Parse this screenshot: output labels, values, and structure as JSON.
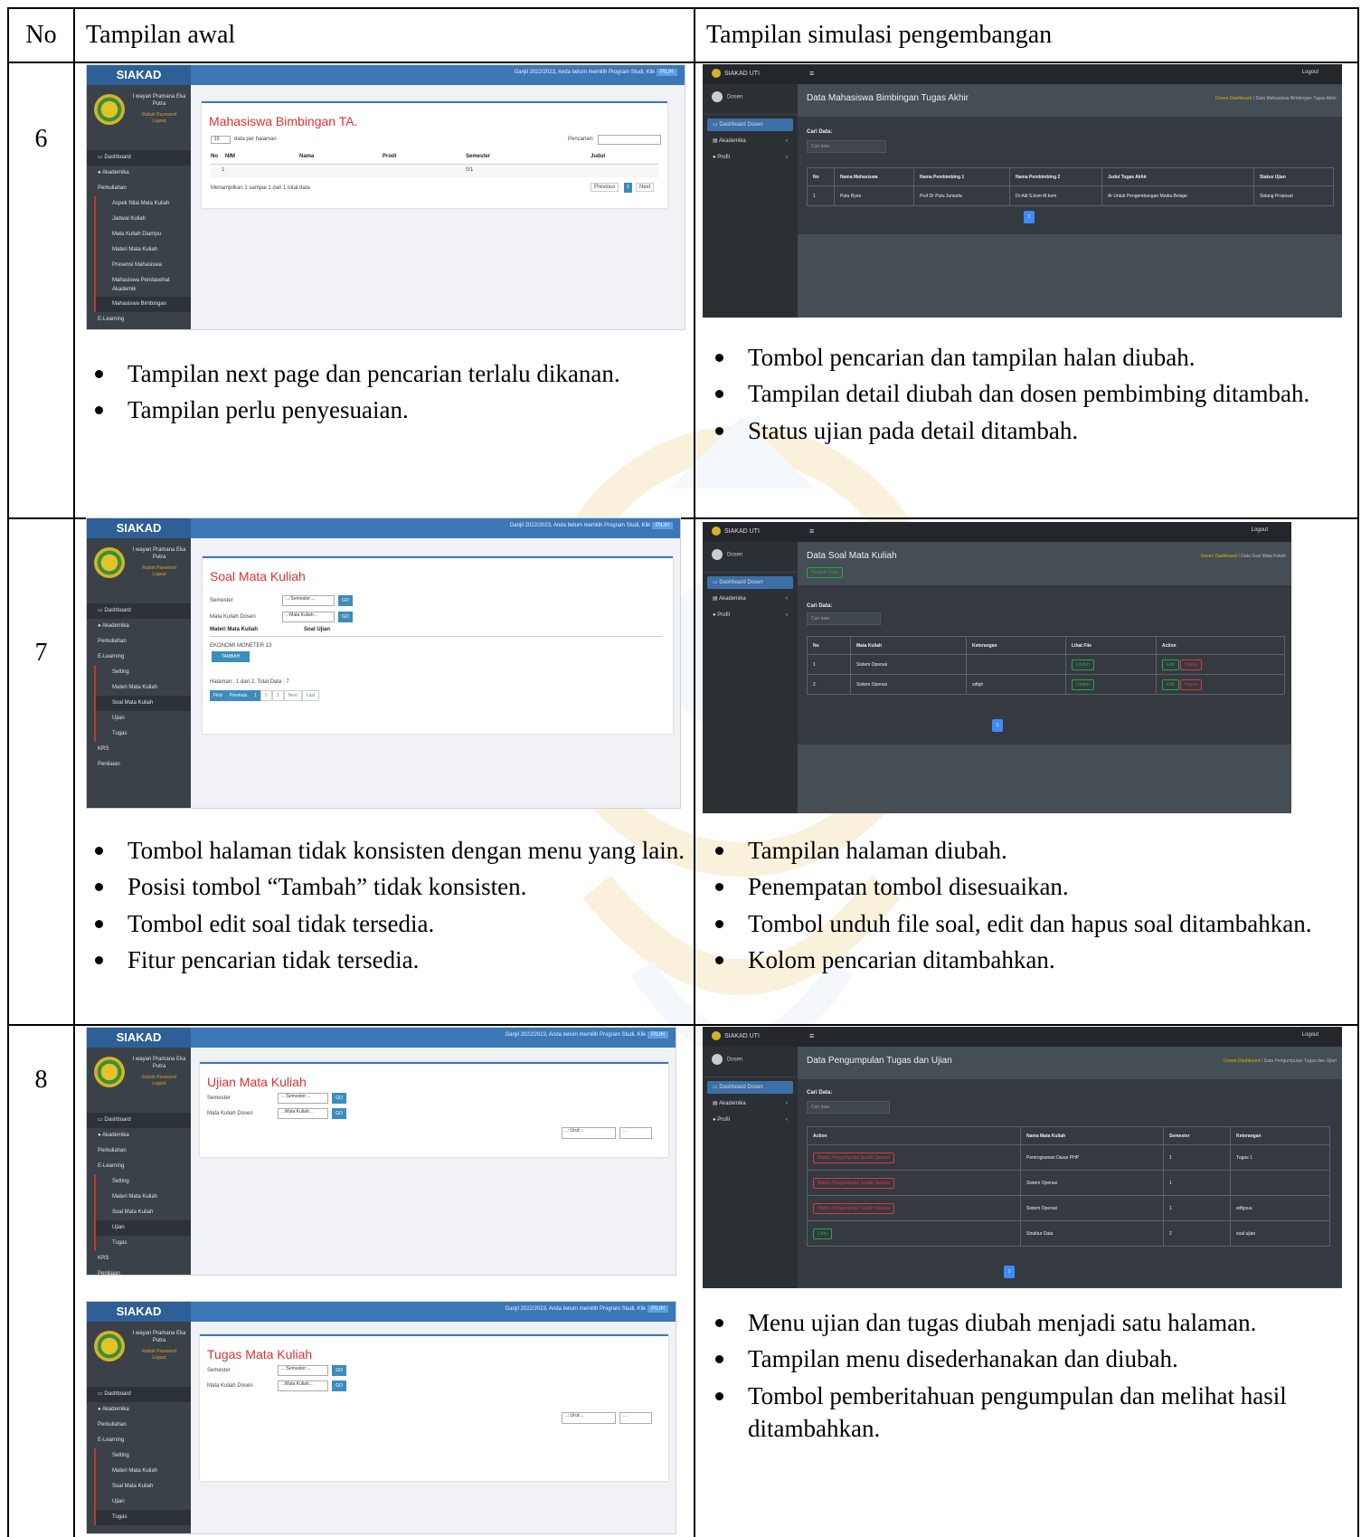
{
  "header": {
    "no": "No",
    "initial_view": "Tampilan awal",
    "dev_view": "Tampilan simulasi pengembangan"
  },
  "rows": [
    {
      "no": "6",
      "old_notes": [
        "Tampilan next page dan pencarian terlalu dikanan.",
        "Tampilan perlu penyesuaian."
      ],
      "new_notes": [
        "Tombol pencarian dan tampilan halan diubah.",
        "Tampilan detail diubah dan dosen pembimbing ditambah.",
        "Status ujian pada detail ditambah."
      ]
    },
    {
      "no": "7",
      "old_notes": [
        "Tombol halaman tidak konsisten dengan menu yang lain.",
        "Posisi tombol “Tambah” tidak konsisten.",
        "Tombol edit soal tidak tersedia.",
        "Fitur pencarian tidak tersedia."
      ],
      "new_notes": [
        "Tampilan halaman diubah.",
        "Penempatan tombol disesuaikan.",
        "Tombol unduh file soal, edit dan hapus soal ditambahkan.",
        "Kolom pencarian ditambahkan."
      ]
    },
    {
      "no": "8",
      "old_notes": [],
      "new_notes": [
        "Menu ujian dan tugas diubah menjadi satu halaman.",
        "Tampilan menu disederhanakan dan diubah.",
        "Tombol pemberitahuan pengumpulan dan melihat hasil ditambahkan."
      ]
    }
  ],
  "old_app": {
    "brand": "SIAKAD",
    "notice": "Ganjil 2022/2023, Anda belum memilih Program Studi, Klik",
    "pilih": "PILIH",
    "user": "I wayan Pramana Eka Putra",
    "change_password": "Rubah Password",
    "logout": "Logout",
    "dashboard": "Dashboard",
    "akademika": "Akademika",
    "perkuliahan": "Perkuliahan",
    "elearning": "E-Learning",
    "setting": "Setting",
    "materi": "Materi Mata Kuliah",
    "soal": "Soal Mata Kuliah",
    "ujian": "Ujian",
    "tugas": "Tugas",
    "krs": "KRS",
    "penilaian": "Penilaian",
    "menu6": [
      "Aspek Nilai Mata Kuliah",
      "Jadwal Kuliah",
      "Mata Kuliah Diampu",
      "Materi Mata Kuliah",
      "Presensi Mahasiswa",
      "Mahasiswa Pendasehat Akademik",
      "Mahasiswa Bimbingan",
      "E-Learning"
    ],
    "bimbingan_title": "Mahasiswa Bimbingan TA.",
    "per_page": "data per halaman",
    "per_page_val": "10",
    "pencarian": "Pencarian:",
    "cols6": [
      "No",
      "NIM",
      "Nama",
      "Prodi",
      "Semester",
      "Judul"
    ],
    "row6": [
      "1",
      "",
      "",
      "",
      "0/1",
      ""
    ],
    "showing": "Menampilkan 1 sampai 1 dari 1 total data",
    "previous": "Previous",
    "next": "Next",
    "page1": "1",
    "soal_title": "Soal Mata Kuliah",
    "semester": "Semester",
    "mk_dosen": "Mata Kuliah Dosen",
    "semester_sel": "...:Semester:...",
    "mk_sel": "..:Mata Kuliah:..",
    "go": "GO",
    "materi_col": "Materi Mata Kuliah",
    "soal_col": "Soal Ujian",
    "ekonomi": "EKONOMI MONETER 13",
    "tambah": "TAMBAH",
    "halaman": "Halaman : 1 dari 2, Total Data : 7",
    "pager7": [
      "First",
      "Previous",
      "1",
      "2",
      "3",
      "Next",
      "Last"
    ],
    "ujian_title": "Ujian Mata Kuliah",
    "tugas_title": "Tugas Mata Kuliah",
    "urut": "..::Urut::..",
    "dots": "..."
  },
  "new_app": {
    "brand": "SIAKAD UTI",
    "logout": "Logout",
    "dosen": "Dosen",
    "dash": "Dashboard Dosen",
    "akademika": "Akademika",
    "profil": "Profil",
    "cari_label": "Cari Data:",
    "cari_ph": "Cari data",
    "crumb_home": "Dosen Dashboard",
    "page1": "1",
    "t6": "Data Mahasiswa Bimbingan Tugas Akhir",
    "cols6": [
      "No",
      "Nama Mahasiswa",
      "Nama Pembimbing 1",
      "Nama Pembimbing 2",
      "Judul Tugas Akhir",
      "Status Ujian"
    ],
    "row6": [
      "1",
      "Putu Ryan",
      "Prof Dr Putu Juniarta",
      "Dr Alit S.kom M.kom",
      "Ar Untuk Pengembangan Media Belajar",
      "Sidang Proposal"
    ],
    "t7": "Data Soal Mata Kuliah",
    "tambah": "Tambah Data",
    "cols7": [
      "No",
      "Mata Kuliah",
      "Keterangan",
      "Lihat File",
      "Action"
    ],
    "rows7": [
      [
        "1",
        "Sistem Operasi",
        ""
      ],
      [
        "2",
        "Sistem Operasi",
        "sdfgh"
      ]
    ],
    "unduh": "Unduh",
    "edit": "Edit",
    "hapus": "Hapus",
    "t8": "Data Pengumpulan Tugas dan Ujian",
    "cols8": [
      "Action",
      "Nama Mata Kuliah",
      "Semester",
      "Keterangan"
    ],
    "rows8": [
      [
        "Waktu Pengumpulan Sudah Selesai",
        "Pemrograman Dasar PHP",
        "1",
        "Tugas 1"
      ],
      [
        "Waktu Pengumpulan Sudah Selesai",
        "Sistem Operasi",
        "1",
        ""
      ],
      [
        "Waktu Pengumpulan Sudah Selesai",
        "Sistem Operasi",
        "1",
        "sdfgsuu"
      ],
      [
        "Lihat",
        "Struktur Data",
        "2",
        "soal ujian"
      ]
    ]
  }
}
